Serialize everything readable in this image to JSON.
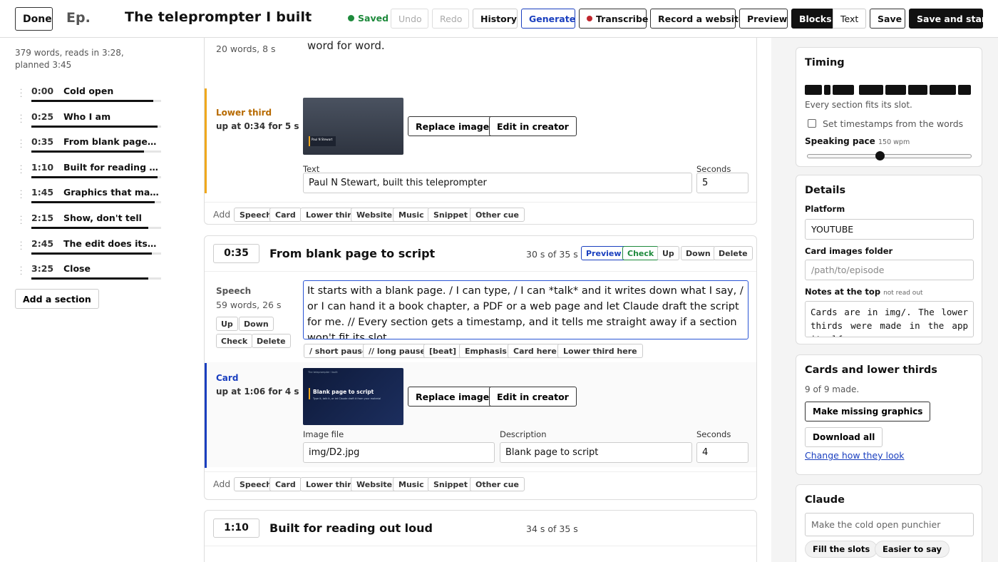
{
  "topbar": {
    "done": "Done",
    "ep": "Ep.",
    "title": "The teleprompter I built",
    "saved": "Saved",
    "undo": "Undo",
    "redo": "Redo",
    "history": "History",
    "generate": "Generate",
    "transcribe": "Transcribe",
    "record_website": "Record a website",
    "preview": "Preview",
    "blocks": "Blocks",
    "text": "Text",
    "save": "Save",
    "save_start": "Save and start"
  },
  "sidebar": {
    "summary": "379 words, reads in 3:28, planned 3:45",
    "sections": [
      {
        "time": "0:00",
        "name": "Cold open",
        "fill": 0.94
      },
      {
        "time": "0:25",
        "name": "Who I am",
        "fill": 0.97
      },
      {
        "time": "0:35",
        "name": "From blank page to script",
        "fill": 0.87
      },
      {
        "time": "1:10",
        "name": "Built for reading out loud",
        "fill": 0.97
      },
      {
        "time": "1:45",
        "name": "Graphics that make themselves",
        "fill": 0.95
      },
      {
        "time": "2:15",
        "name": "Show, don't tell",
        "fill": 0.9
      },
      {
        "time": "2:45",
        "name": "The edit does itself",
        "fill": 0.93
      },
      {
        "time": "3:25",
        "name": "Close",
        "fill": 0.9
      }
    ],
    "add_section": "Add a section"
  },
  "main": {
    "top_card": {
      "meta": "20 words, 8 s",
      "text_tail": "word for word.",
      "lower_third": {
        "kind": "Lower third",
        "when": "up at 0:34 for 5 s",
        "thumb_name": "Paul N Stewart",
        "replace": "Replace image",
        "edit": "Edit in creator",
        "text_label": "Text",
        "text_value": "Paul N Stewart, built this teleprompter",
        "seconds_label": "Seconds",
        "seconds_value": "5"
      }
    },
    "add_row": {
      "add": "Add",
      "chips": [
        "Speech",
        "Card",
        "Lower third",
        "Website",
        "Music",
        "Snippet",
        "Other cue"
      ]
    },
    "section": {
      "time": "0:35",
      "title": "From blank page to script",
      "fit": "30 s of 35 s",
      "btns": {
        "preview": "Preview",
        "check": "Check",
        "up": "Up",
        "down": "Down",
        "delete": "Delete"
      },
      "speech": {
        "kind": "Speech",
        "meta": "59 words, 26 s",
        "up": "Up",
        "down": "Down",
        "check": "Check",
        "delete": "Delete",
        "text": "It starts with a blank page. / I can type, / I can *talk* and it writes down what I say, / or I can hand it a book chapter, a PDF or a web page and let Claude draft the script for me. // Every section gets a timestamp, and it tells me straight away if a section won't fit its slot.",
        "chips": [
          "/ short pause",
          "// long pause",
          "[beat]",
          "Emphasis",
          "Card here",
          "Lower third here"
        ]
      },
      "card_cue": {
        "kind": "Card",
        "when": "up at 1:06 for 4 s",
        "thumb_title": "Blank page to script",
        "thumb_sub": "Type it, talk it, or let Claude draft it from your material",
        "thumb_top": "The teleprompter I built",
        "replace": "Replace image",
        "edit": "Edit in creator",
        "file_label": "Image file",
        "file_value": "img/D2.jpg",
        "desc_label": "Description",
        "desc_value": "Blank page to script",
        "seconds_label": "Seconds",
        "seconds_value": "4"
      }
    },
    "next_section": {
      "time": "1:10",
      "title": "Built for reading out loud",
      "fit": "34 s of 35 s"
    }
  },
  "right": {
    "timing": {
      "title": "Timing",
      "status": "Every section fits its slot.",
      "checkbox_label": "Set timestamps from the words",
      "pace_label": "Speaking pace",
      "pace_value": "150 wpm",
      "pace_fraction": 0.44
    },
    "details": {
      "title": "Details",
      "platform_label": "Platform",
      "platform_value": "YOUTUBE",
      "folder_label": "Card images folder",
      "folder_placeholder": "/path/to/episode",
      "notes_label": "Notes at the top",
      "notes_hint": "not read out",
      "notes_value": "Cards are in img/. The lower thirds were made in the app itself."
    },
    "cards": {
      "title": "Cards and lower thirds",
      "count": "9 of 9 made.",
      "make_missing": "Make missing graphics",
      "download_all": "Download all",
      "change_link": "Change how they look"
    },
    "claude": {
      "title": "Claude",
      "placeholder": "Make the cold open punchier",
      "fill": "Fill the slots",
      "easier": "Easier to say"
    }
  }
}
